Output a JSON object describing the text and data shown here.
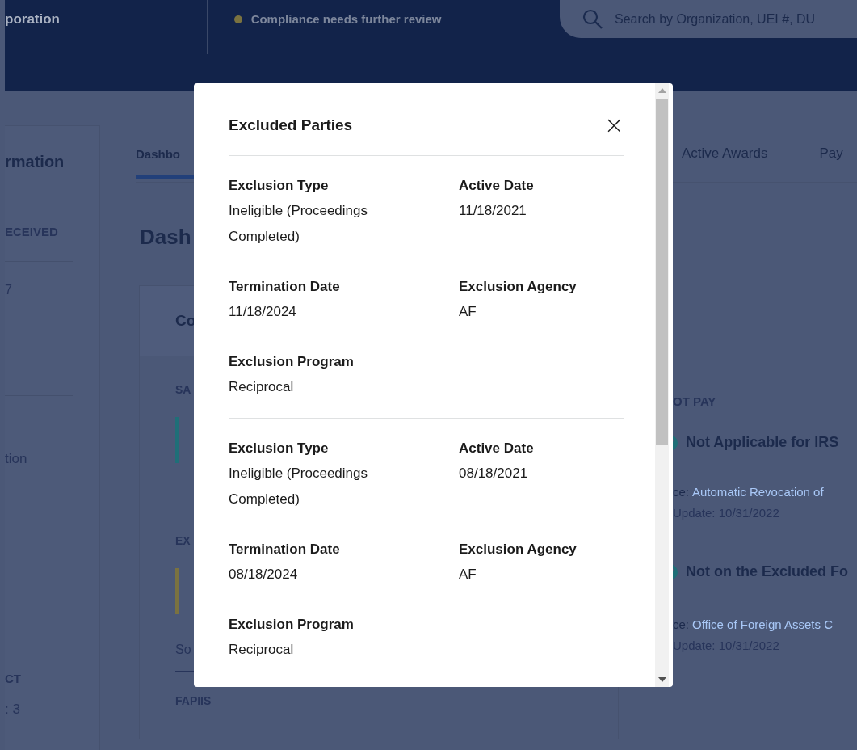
{
  "header": {
    "org_name": "poration",
    "status": {
      "text": "Compliance needs further review",
      "color": "#7a7240"
    },
    "search": {
      "placeholder": "Search by Organization, UEI #, DU"
    }
  },
  "sidebar": {
    "title": "rmation",
    "items": [
      {
        "kind": "heading",
        "text": "ECEIVED"
      },
      {
        "kind": "value",
        "text": "7"
      },
      {
        "kind": "divider"
      },
      {
        "kind": "value",
        "text": "tion"
      },
      {
        "kind": "heading",
        "text": "CT"
      },
      {
        "kind": "value",
        "text": ": 3"
      }
    ]
  },
  "tabs": [
    {
      "label": "Dashbo",
      "selected": true
    },
    {
      "label": "Active Awards",
      "selected": false
    },
    {
      "label": "Pay",
      "selected": false
    }
  ],
  "page_heading": "Dash",
  "compliance_card": {
    "title": "Co",
    "sections": [
      {
        "heading": "SA",
        "color": "#1f6f78"
      },
      {
        "heading": "EX",
        "color": "#7a7240"
      }
    ],
    "source": "So",
    "footer_heading": "FAPIIS"
  },
  "right_panel": {
    "heading": "OT PAY",
    "items": [
      {
        "title": "Not Applicable for IRS",
        "source_prefix": "ce:",
        "source_link": "Automatic Revocation of",
        "update": "Update: 10/31/2022"
      },
      {
        "title": "Not on the Excluded Fo",
        "source_prefix": "ce:",
        "source_link": "Office of Foreign Assets C",
        "update": "Update: 10/31/2022"
      }
    ]
  },
  "modal": {
    "title": "Excluded Parties",
    "close": "×",
    "entries": [
      {
        "fields": [
          {
            "label": "Exclusion Type",
            "value": "Ineligible (Proceedings Completed)"
          },
          {
            "label": "Active Date",
            "value": "11/18/2021"
          },
          {
            "label": "Termination Date",
            "value": "11/18/2024"
          },
          {
            "label": "Exclusion Agency",
            "value": "AF"
          },
          {
            "label": "Exclusion Program",
            "value": "Reciprocal"
          }
        ]
      },
      {
        "fields": [
          {
            "label": "Exclusion Type",
            "value": "Ineligible (Proceedings Completed)"
          },
          {
            "label": "Active Date",
            "value": "08/18/2021"
          },
          {
            "label": "Termination Date",
            "value": "08/18/2024"
          },
          {
            "label": "Exclusion Agency",
            "value": "AF"
          },
          {
            "label": "Exclusion Program",
            "value": "Reciprocal"
          }
        ]
      }
    ]
  }
}
